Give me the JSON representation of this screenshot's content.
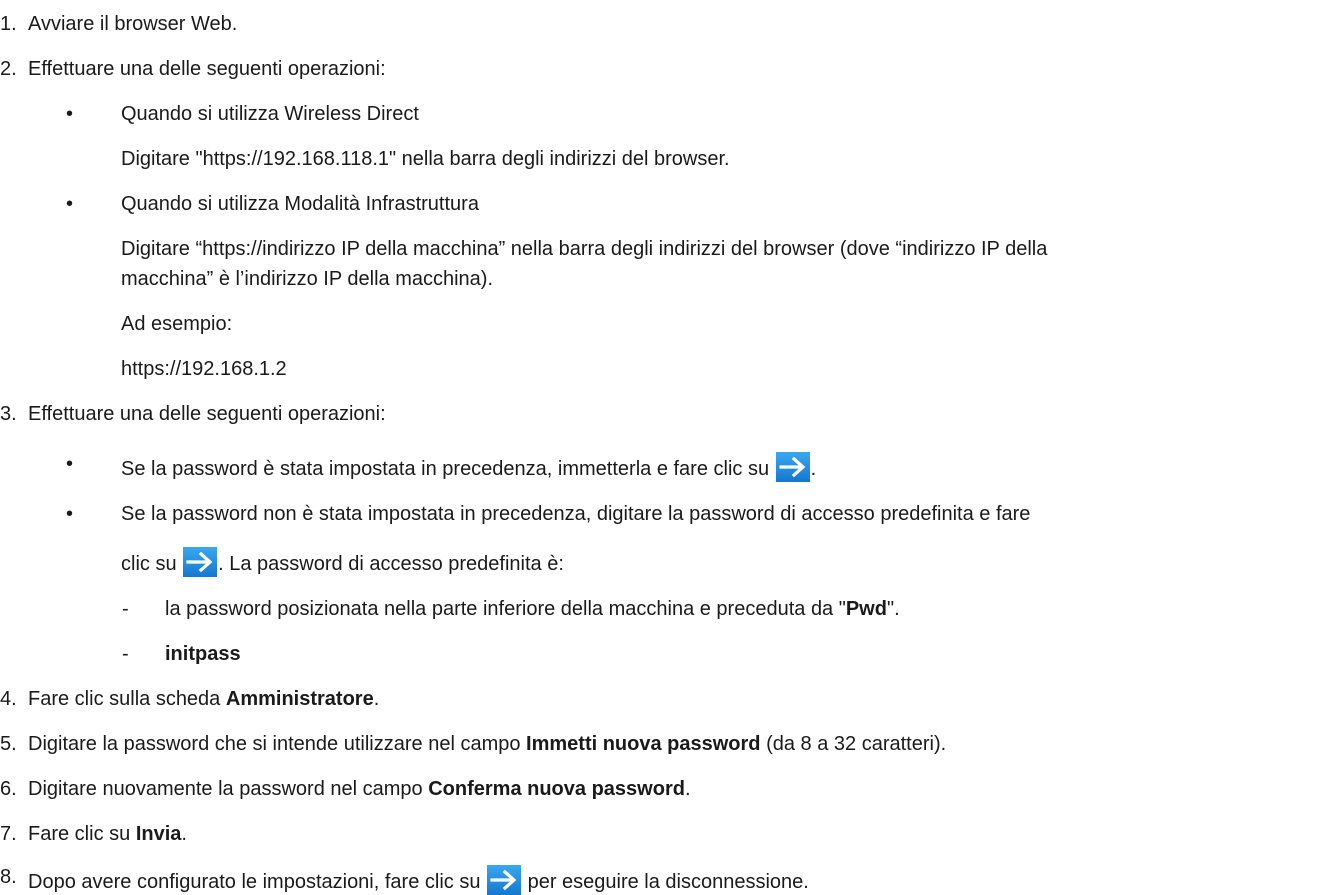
{
  "steps": [
    {
      "num": "1.",
      "text": "Avviare il browser Web."
    },
    {
      "num": "2.",
      "text": "Effettuare una delle seguenti operazioni:",
      "options": [
        {
          "bullet": "•",
          "title": "Quando si utilizza Wireless Direct",
          "body": "Digitare \"https://192.168.118.1\" nella barra degli indirizzi del browser."
        },
        {
          "bullet": "•",
          "title": "Quando si utilizza Modalità Infrastruttura",
          "body_line1": "Digitare “https://indirizzo IP della macchina” nella barra degli indirizzi del browser (dove “indirizzo IP della",
          "body_line2": "macchina” è l’indirizzo IP della macchina).",
          "example_label": "Ad esempio:",
          "example_value": "https://192.168.1.2"
        }
      ]
    },
    {
      "num": "3.",
      "text": "Effettuare una delle seguenti operazioni:",
      "options": [
        {
          "bullet": "•",
          "text_before": "Se la password è stata impostata in precedenza, immetterla e fare clic su ",
          "text_after": "."
        },
        {
          "bullet": "•",
          "line1": "Se la password non è stata impostata in precedenza, digitare la password di accesso predefinita e fare",
          "line2_before": "clic su ",
          "line2_after": ". La password di accesso predefinita è:",
          "subitems": [
            {
              "dash": "-",
              "before": "la password posizionata nella parte inferiore della macchina e preceduta da \"",
              "bold": "Pwd",
              "after": "\"."
            },
            {
              "dash": "-",
              "bold": "initpass"
            }
          ]
        }
      ]
    },
    {
      "num": "4.",
      "before": "Fare clic sulla scheda ",
      "bold": "Amministratore",
      "after": "."
    },
    {
      "num": "5.",
      "before": "Digitare la password che si intende utilizzare nel campo ",
      "bold": "Immetti nuova password",
      "after": " (da 8 a 32 caratteri)."
    },
    {
      "num": "6.",
      "before": "Digitare nuovamente la password nel campo ",
      "bold": "Conferma nuova password",
      "after": "."
    },
    {
      "num": "7.",
      "before": "Fare clic su ",
      "bold": "Invia",
      "after": "."
    },
    {
      "num": "8.",
      "before": "Dopo avere configurato le impostazioni, fare clic su ",
      "after": " per eseguire la disconnessione."
    }
  ],
  "icons": {
    "arrow": "right-arrow-icon",
    "arrow_color": "#1f8fe0"
  }
}
